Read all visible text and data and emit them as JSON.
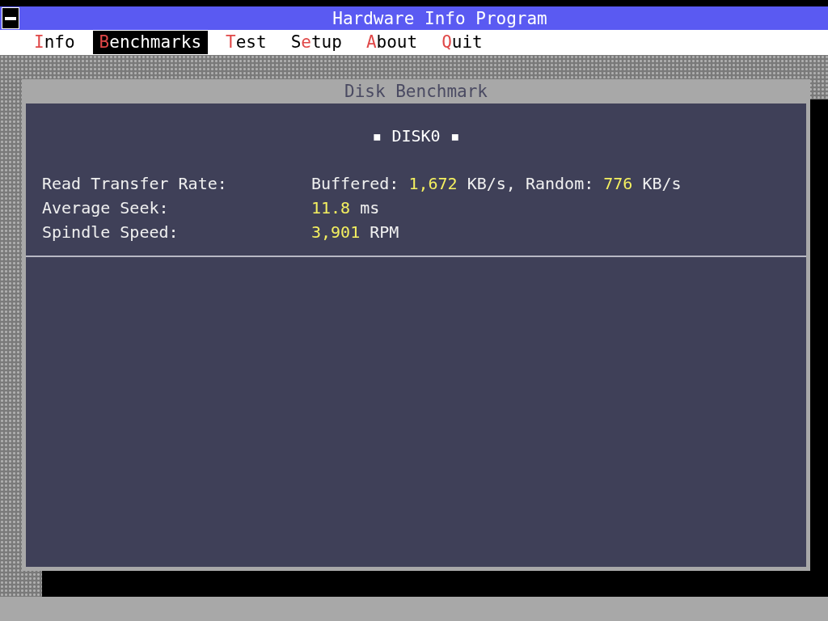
{
  "window": {
    "title": "Hardware Info Program"
  },
  "menu": [
    {
      "key": "I",
      "post": "nfo",
      "selected": false
    },
    {
      "key": "B",
      "post": "enchmarks",
      "selected": true
    },
    {
      "key": "T",
      "post": "est",
      "selected": false
    },
    {
      "pre": "S",
      "key": "e",
      "post": "tup",
      "selected": false
    },
    {
      "key": "A",
      "post": "bout",
      "selected": false
    },
    {
      "key": "Q",
      "post": "uit",
      "selected": false
    }
  ],
  "dialog": {
    "title": "Disk Benchmark",
    "heading": "▪ DISK0 ▪",
    "rows": [
      {
        "label": "Read Transfer Rate:",
        "value": [
          {
            "kind": "text",
            "text": "Buffered: "
          },
          {
            "kind": "number",
            "text": "1,672"
          },
          {
            "kind": "text",
            "text": " KB/s, Random: "
          },
          {
            "kind": "number",
            "text": "776"
          },
          {
            "kind": "text",
            "text": " KB/s"
          }
        ]
      },
      {
        "label": "Average Seek:",
        "value": [
          {
            "kind": "number",
            "text": "11.8"
          },
          {
            "kind": "text",
            "text": " ms"
          }
        ]
      },
      {
        "label": "Spindle Speed:",
        "value": [
          {
            "kind": "number",
            "text": "3,901"
          },
          {
            "kind": "text",
            "text": " RPM"
          }
        ]
      }
    ]
  }
}
